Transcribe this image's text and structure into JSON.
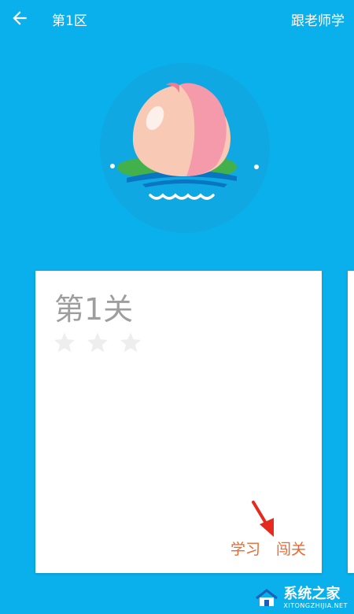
{
  "header": {
    "title": "第1区",
    "right_link": "跟老师学",
    "back_icon": "back-arrow-icon"
  },
  "hero": {
    "icon": "peach-icon"
  },
  "level_card": {
    "title": "第1关",
    "stars_filled": 0,
    "stars_total": 3,
    "learn_label": "学习",
    "challenge_label": "闯关"
  },
  "watermark": {
    "main": "系统之家",
    "sub": "XITONGZHIJIA.NET"
  },
  "colors": {
    "background": "#0AB0EB",
    "card": "#FFFFFF",
    "title_gray": "#9E9E9E",
    "star_empty": "#EEEEEE",
    "action_orange": "#E8692F",
    "arrow_red": "#E52A1E"
  }
}
